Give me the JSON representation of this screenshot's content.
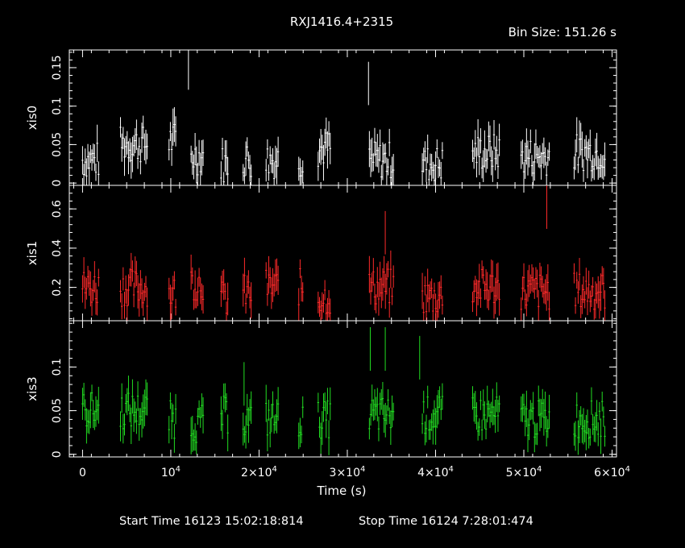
{
  "header": {
    "title": "RXJ1416.4+2315",
    "bin_size": "Bin Size: 151.26 s"
  },
  "footer": {
    "start": "Start Time 16123 15:02:18:814",
    "stop": "Stop Time 16124  7:28:01:474"
  },
  "chart_data": {
    "type": "scatter",
    "title": "RXJ1416.4+2315",
    "xlabel": "Time (s)",
    "xlim": [
      -1500,
      60500
    ],
    "x_ticks": [
      0,
      10000,
      20000,
      30000,
      40000,
      50000,
      60000
    ],
    "x_tick_labels": [
      "0",
      "10^4",
      "2×10^4",
      "3×10^4",
      "4×10^4",
      "5×10^4",
      "6×10^4"
    ],
    "grid": false,
    "segments": [
      [
        0,
        1900
      ],
      [
        4300,
        7400
      ],
      [
        9800,
        10600
      ],
      [
        12300,
        13700
      ],
      [
        15700,
        16500
      ],
      [
        18200,
        19200
      ],
      [
        20800,
        22200
      ],
      [
        24500,
        25000
      ],
      [
        26700,
        28100
      ],
      [
        32500,
        35300
      ],
      [
        38500,
        40800
      ],
      [
        44200,
        47300
      ],
      [
        49700,
        52900
      ],
      [
        55700,
        59300
      ]
    ],
    "panels": [
      {
        "name": "xis0",
        "ylabel": "xis0",
        "color": "#ffffff",
        "ylim": [
          -0.003,
          0.173
        ],
        "y_ticks": [
          0,
          0.05,
          0.1,
          0.15
        ],
        "y_tick_labels": [
          "0",
          "0.05",
          "0.1",
          "0.15"
        ],
        "seg_levels": [
          0.03,
          0.05,
          0.055,
          0.035,
          0.025,
          0.03,
          0.03,
          0.03,
          0.045,
          0.03,
          0.025,
          0.04,
          0.035,
          0.04
        ],
        "spikes": [
          {
            "x": 12000,
            "y": 0.16
          },
          {
            "x": 32400,
            "y": 0.14
          }
        ]
      },
      {
        "name": "xis1",
        "ylabel": "xis1",
        "color": "#ff2a2a",
        "ylim": [
          0.03,
          0.72
        ],
        "y_ticks": [
          0.2,
          0.4,
          0.6
        ],
        "y_tick_labels": [
          "0.2",
          "0.4",
          "0.6"
        ],
        "seg_levels": [
          0.2,
          0.2,
          0.17,
          0.23,
          0.14,
          0.17,
          0.2,
          0.2,
          0.15,
          0.2,
          0.15,
          0.2,
          0.18,
          0.18
        ],
        "spikes": [
          {
            "x": 34300,
            "y": 0.52
          },
          {
            "x": 52600,
            "y": 0.65
          }
        ]
      },
      {
        "name": "xis3",
        "ylabel": "xis3",
        "color": "#22dd22",
        "ylim": [
          -0.003,
          0.153
        ],
        "y_ticks": [
          0,
          0.05,
          0.1
        ],
        "y_tick_labels": [
          "0",
          "0.05",
          "0.1"
        ],
        "seg_levels": [
          0.05,
          0.05,
          0.04,
          0.035,
          0.045,
          0.04,
          0.04,
          0.04,
          0.04,
          0.045,
          0.045,
          0.045,
          0.04,
          0.04
        ],
        "spikes": [
          {
            "x": 18300,
            "y": 0.09
          },
          {
            "x": 32600,
            "y": 0.13
          },
          {
            "x": 34300,
            "y": 0.13
          },
          {
            "x": 38200,
            "y": 0.12
          }
        ]
      }
    ]
  }
}
